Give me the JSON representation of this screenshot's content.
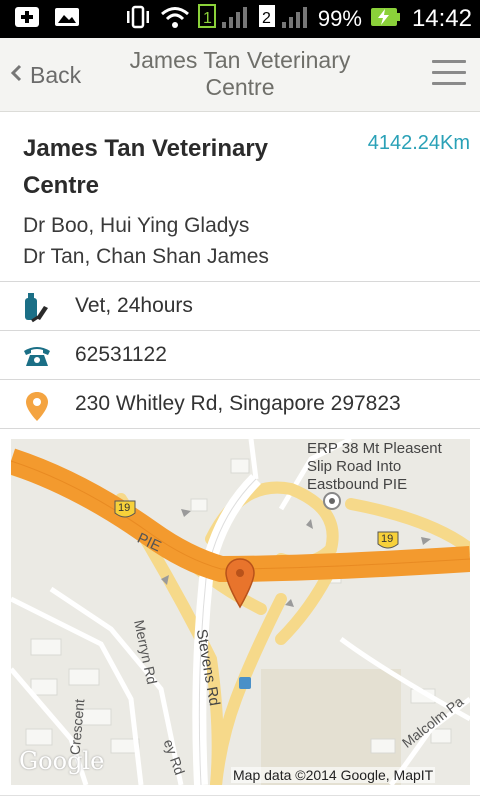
{
  "status_bar": {
    "sim1": "1",
    "sim2": "2",
    "battery": "99%",
    "time": "14:42"
  },
  "header": {
    "back_label": "Back",
    "title": "James Tan Veterinary Centre"
  },
  "clinic": {
    "name": "James Tan Veterinary Centre",
    "distance": "4142.24Km",
    "doctors": [
      "Dr Boo, Hui Ying Gladys",
      "Dr Tan, Chan Shan James"
    ]
  },
  "details": {
    "type": "Vet, 24hours",
    "phone": "62531122",
    "address": "230 Whitley Rd, Singapore 297823"
  },
  "map": {
    "poi_label": [
      "ERP 38 Mt Pleasent",
      "Slip Road Into",
      "Eastbound PIE"
    ],
    "road_pie": "PIE",
    "road_stevens": "Stevens Rd",
    "road_merryn": "Merryn Rd",
    "road_malcolm": "Malcolm Pa",
    "road_crescent": "Crescent",
    "road_partial": "ey Rd",
    "shield_1": "19",
    "shield_2": "19",
    "google_logo": "Google",
    "attribution": "Map data ©2014 Google, MapIT"
  },
  "colors": {
    "accent": "#2aa1b7",
    "expressway": "#f39a2e",
    "road_yellow": "#f6d98a",
    "pin": "#e8742c"
  }
}
